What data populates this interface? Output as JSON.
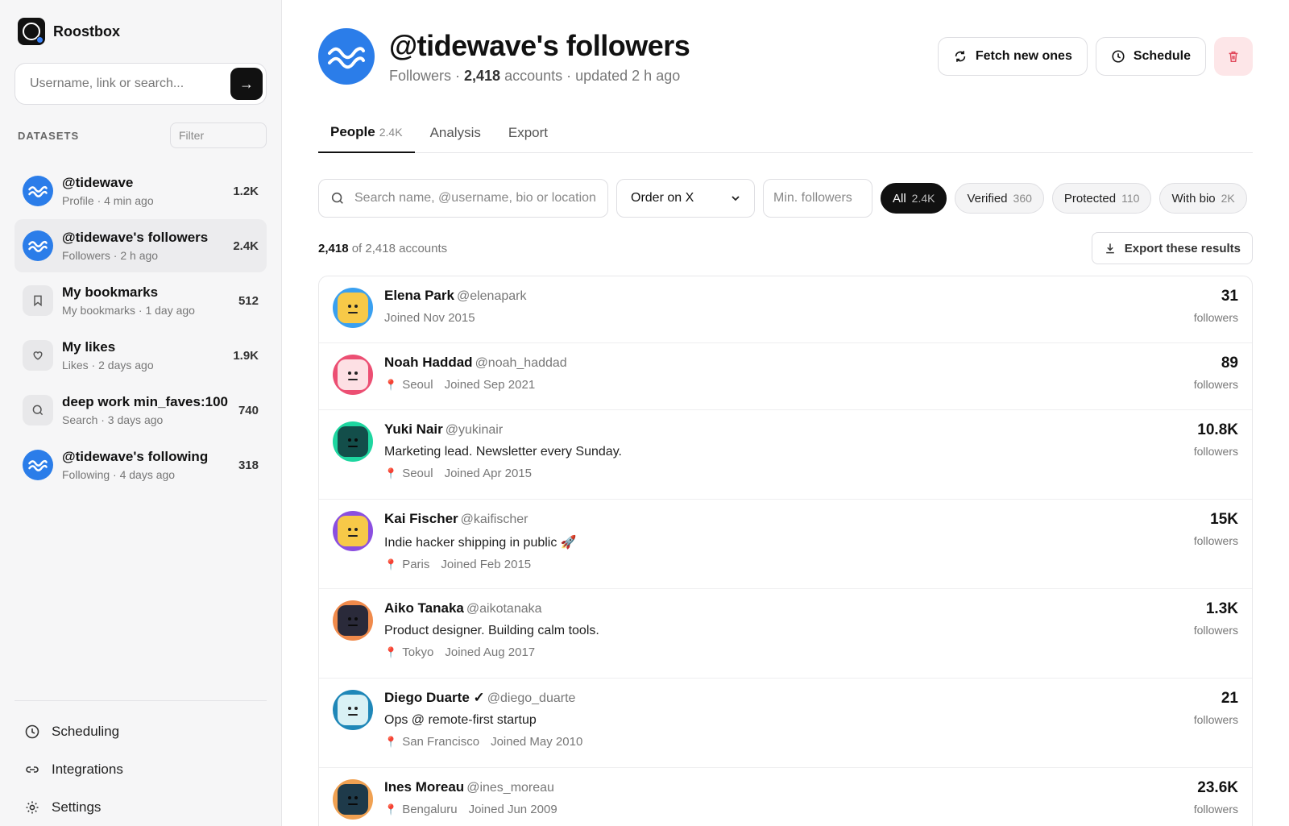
{
  "app": {
    "name": "Roostbox"
  },
  "sidebar": {
    "search_placeholder": "Username, link or search...",
    "datasets_title": "DATASETS",
    "filter_placeholder": "Filter",
    "datasets": [
      {
        "name": "@tidewave",
        "sub": "Profile · 4 min ago",
        "count": "1.2K",
        "icon": "brand-avatar",
        "active": false
      },
      {
        "name": "@tidewave's followers",
        "sub": "Followers · 2 h ago",
        "count": "2.4K",
        "icon": "brand-avatar",
        "active": true
      },
      {
        "name": "My bookmarks",
        "sub": "My bookmarks · 1 day ago",
        "count": "512",
        "icon": "bookmark-icon",
        "active": false
      },
      {
        "name": "My likes",
        "sub": "Likes · 2 days ago",
        "count": "1.9K",
        "icon": "heart-icon",
        "active": false
      },
      {
        "name": "deep work min_faves:100",
        "sub": "Search · 3 days ago",
        "count": "740",
        "icon": "search-icon",
        "active": false
      },
      {
        "name": "@tidewave's following",
        "sub": "Following · 4 days ago",
        "count": "318",
        "icon": "brand-avatar",
        "active": false
      }
    ],
    "links": [
      {
        "label": "Scheduling",
        "icon": "clock-icon"
      },
      {
        "label": "Integrations",
        "icon": "link-icon"
      },
      {
        "label": "Settings",
        "icon": "gear-icon"
      }
    ]
  },
  "header": {
    "title": "@tidewave's followers",
    "sub_prefix": "Followers · ",
    "count": "2,418",
    "sub_suffix": " accounts · updated 2 h ago",
    "fetch_label": "Fetch new ones",
    "schedule_label": "Schedule"
  },
  "tabs": [
    {
      "label": "People",
      "count": "2.4K",
      "active": true
    },
    {
      "label": "Analysis",
      "count": "",
      "active": false
    },
    {
      "label": "Export",
      "count": "",
      "active": false
    }
  ],
  "filters": {
    "search_placeholder": "Search name, @username, bio or location",
    "order_value": "Order on X",
    "min_followers_placeholder": "Min. followers",
    "chips": [
      {
        "label": "All",
        "count": "2.4K",
        "active": true
      },
      {
        "label": "Verified",
        "count": "360",
        "active": false
      },
      {
        "label": "Protected",
        "count": "110",
        "active": false
      },
      {
        "label": "With bio",
        "count": "2K",
        "active": false
      }
    ]
  },
  "results": {
    "shown": "2,418",
    "total_text": " of 2,418 accounts",
    "export_label": "Export these results"
  },
  "people": [
    {
      "name": "Elena Park",
      "handle": "@elenapark",
      "bio": "",
      "location": "",
      "joined": "Joined Nov 2015",
      "followers": "31",
      "followers_label": "followers",
      "ring": "#3aa0f0",
      "face": "#f7c948"
    },
    {
      "name": "Noah Haddad",
      "handle": "@noah_haddad",
      "bio": "",
      "location": "Seoul",
      "joined": "Joined Sep 2021",
      "followers": "89",
      "followers_label": "followers",
      "ring": "#ec4f73",
      "face": "#fde0e4"
    },
    {
      "name": "Yuki Nair",
      "handle": "@yukinair",
      "bio": "Marketing lead. Newsletter every Sunday.",
      "location": "Seoul",
      "joined": "Joined Apr 2015",
      "followers": "10.8K",
      "followers_label": "followers",
      "ring": "#1ed6a0",
      "face": "#134e4a"
    },
    {
      "name": "Kai Fischer",
      "handle": "@kaifischer",
      "bio": "Indie hacker shipping in public 🚀",
      "location": "Paris",
      "joined": "Joined Feb 2015",
      "followers": "15K",
      "followers_label": "followers",
      "ring": "#8b4fe0",
      "face": "#f7c948"
    },
    {
      "name": "Aiko Tanaka",
      "handle": "@aikotanaka",
      "bio": "Product designer. Building calm tools.",
      "location": "Tokyo",
      "joined": "Joined Aug 2017",
      "followers": "1.3K",
      "followers_label": "followers",
      "ring": "#f08a4b",
      "face": "#2a2a3a"
    },
    {
      "name": "Diego Duarte ✓",
      "handle": "@diego_duarte",
      "bio": "Ops @ remote-first startup",
      "location": "San Francisco",
      "joined": "Joined May 2010",
      "followers": "21",
      "followers_label": "followers",
      "ring": "#1f87b8",
      "face": "#d9f1f5"
    },
    {
      "name": "Ines Moreau",
      "handle": "@ines_moreau",
      "bio": "",
      "location": "Bengaluru",
      "joined": "Joined Jun 2009",
      "followers": "23.6K",
      "followers_label": "followers",
      "ring": "#f0a152",
      "face": "#1e3a4a"
    }
  ],
  "colors": {
    "accent": "#111111",
    "brand_blue": "#2b7de9",
    "danger": "#e0475a"
  }
}
